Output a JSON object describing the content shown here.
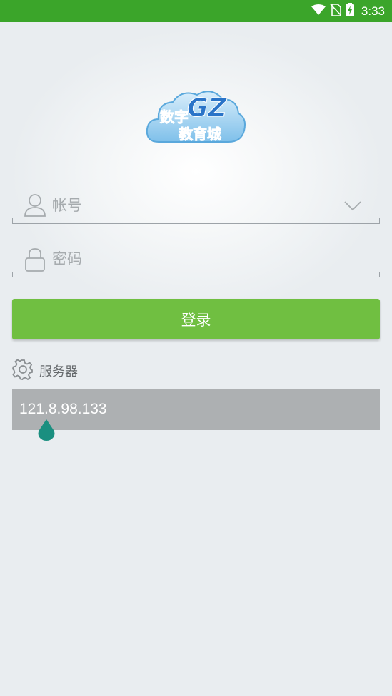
{
  "status_bar": {
    "time": "3:33"
  },
  "logo": {
    "badge": "GZ",
    "line1": "数字",
    "line2": "教育城"
  },
  "login_form": {
    "account_placeholder": "帐号",
    "password_placeholder": "密码",
    "login_label": "登录"
  },
  "server": {
    "label": "服务器",
    "address": "121.8.98.133"
  },
  "colors": {
    "status_bar": "#3ba52a",
    "login_button": "#70bf41",
    "server_field": "#adb0b2",
    "text_cursor_handle": "#1a8f80"
  }
}
